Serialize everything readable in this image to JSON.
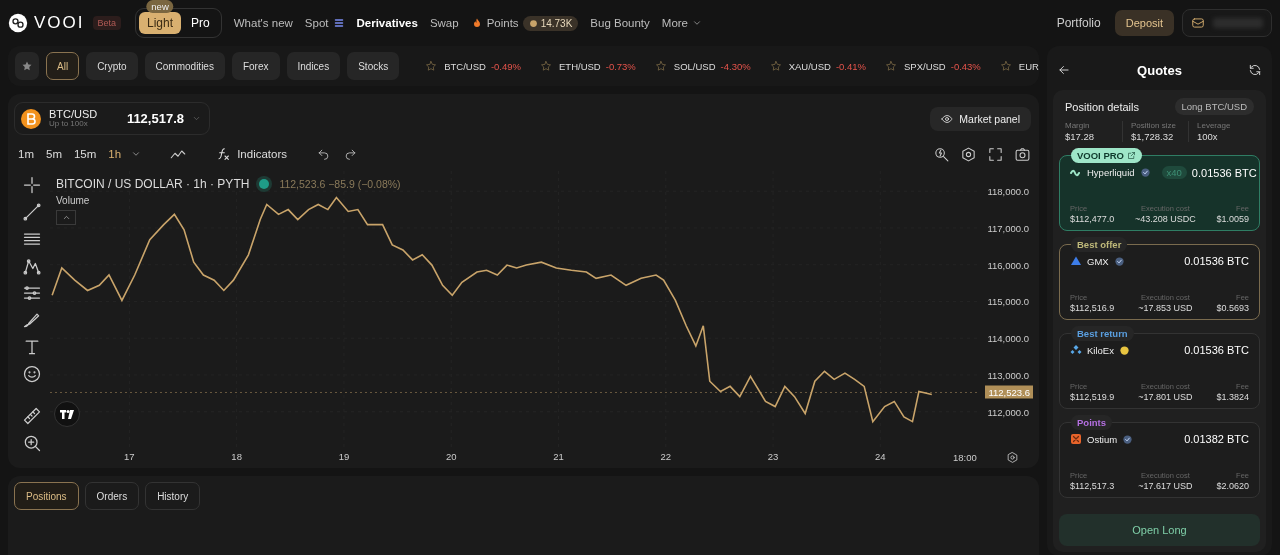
{
  "header": {
    "logo": "VOOI",
    "beta": "Beta",
    "modes": [
      {
        "label": "Light",
        "badge": "new",
        "selected": true
      },
      {
        "label": "Pro",
        "selected": false
      }
    ],
    "nav": [
      {
        "kind": "link",
        "label": "What's new",
        "selected": false
      },
      {
        "kind": "spot",
        "label": "Spot",
        "selected": false
      },
      {
        "kind": "link",
        "label": "Derivatives",
        "selected": true
      },
      {
        "kind": "link",
        "label": "Swap",
        "selected": false
      },
      {
        "kind": "points",
        "label": "Points",
        "badge": "14.73K",
        "selected": false
      },
      {
        "kind": "link",
        "label": "Bug Bounty",
        "selected": false
      },
      {
        "kind": "menu",
        "label": "More",
        "selected": false
      }
    ],
    "portfolio": "Portfolio",
    "deposit": "Deposit"
  },
  "filters": [
    {
      "label": "All",
      "selected": true
    },
    {
      "label": "Crypto",
      "selected": false
    },
    {
      "label": "Commodities",
      "selected": false
    },
    {
      "label": "Forex",
      "selected": false
    },
    {
      "label": "Indices",
      "selected": false
    },
    {
      "label": "Stocks",
      "selected": false
    }
  ],
  "tickers": [
    {
      "pair": "BTC/USD",
      "change": "-0.49%"
    },
    {
      "pair": "ETH/USD",
      "change": "-0.73%"
    },
    {
      "pair": "SOL/USD",
      "change": "-4.30%"
    },
    {
      "pair": "XAU/USD",
      "change": "-0.41%"
    },
    {
      "pair": "SPX/USD",
      "change": "-0.43%"
    },
    {
      "pair": "EUR"
    }
  ],
  "market": {
    "pair": "BTC/USD",
    "leverage": "Up to 100x",
    "price": "112,517.8",
    "panel_button": "Market panel"
  },
  "toolbar": {
    "intervals": [
      {
        "label": "1m",
        "selected": false
      },
      {
        "label": "5m",
        "selected": false
      },
      {
        "label": "15m",
        "selected": false
      },
      {
        "label": "1h",
        "selected": true
      }
    ],
    "indicators": "Indicators"
  },
  "chart": {
    "legend": "BITCOIN / US DOLLAR · 1h · PYTH",
    "quote": "112,523.6 −85.9 (−0.08%)",
    "volume": "Volume",
    "chart_data": {
      "type": "line",
      "x": [
        16.28,
        16.37,
        16.49,
        16.61,
        16.72,
        16.81,
        16.93,
        17.05,
        17.19,
        17.32,
        17.42,
        17.51,
        17.6,
        17.69,
        17.79,
        17.88,
        17.97,
        18.11,
        18.22,
        18.28,
        18.39,
        18.48,
        18.57,
        18.67,
        18.76,
        18.85,
        18.93,
        19.04,
        19.13,
        19.22,
        19.36,
        19.45,
        19.55,
        19.64,
        19.73,
        19.82,
        19.92,
        20.01,
        20.1,
        20.24,
        20.33,
        20.43,
        20.52,
        20.61,
        20.7,
        20.84,
        20.98,
        21.12,
        21.26,
        21.35,
        21.49,
        21.63,
        21.77,
        21.91,
        21.98,
        22.09,
        22.19,
        22.28,
        22.35,
        22.41,
        22.51,
        22.6,
        22.69,
        22.79,
        22.93,
        23.02,
        23.11,
        23.2,
        23.3,
        23.39,
        23.48,
        23.57,
        23.67,
        23.76,
        23.85,
        23.93,
        24.04,
        24.13,
        24.22,
        24.3,
        24.36,
        24.48
      ],
      "series": [
        {
          "color": "#c9a46a",
          "values": [
            115170,
            115910,
            115580,
            115300,
            115440,
            115720,
            115030,
            115720,
            116680,
            117090,
            117370,
            116950,
            116070,
            115720,
            115580,
            115300,
            115580,
            116270,
            117230,
            117640,
            117370,
            117500,
            117230,
            117500,
            117640,
            117500,
            117830,
            117450,
            117500,
            117090,
            117090,
            116540,
            116400,
            116130,
            116270,
            115990,
            115440,
            115170,
            115520,
            115800,
            115850,
            115720,
            115990,
            115910,
            115990,
            116070,
            115910,
            115850,
            115800,
            115630,
            115720,
            115440,
            115630,
            115720,
            115580,
            115030,
            114340,
            113790,
            114340,
            112830,
            112550,
            112690,
            112410,
            112960,
            112280,
            112140,
            112690,
            112410,
            111950,
            112830,
            113100,
            112880,
            113050,
            112880,
            112690,
            111730,
            112140,
            112280,
            111860,
            111730,
            112550,
            112470
          ]
        }
      ],
      "xlim": [
        16.26,
        24.92
      ],
      "ylim": [
        111040,
        118550
      ],
      "xticks": [
        17,
        18,
        19,
        20,
        21,
        22,
        23,
        24
      ],
      "yticks": [
        {
          "value": 112000,
          "label": "112,000.0"
        },
        {
          "value": 113000,
          "label": "113,000.0"
        },
        {
          "value": 114000,
          "label": "114,000.0"
        },
        {
          "value": 115000,
          "label": "115,000.0"
        },
        {
          "value": 116000,
          "label": "116,000.0"
        },
        {
          "value": 117000,
          "label": "117,000.0"
        },
        {
          "value": 118000,
          "label": "118,000.0"
        }
      ],
      "grid": true,
      "ref_lines": [
        {
          "axis": "y",
          "value": 112523.6,
          "label": "112,523.6"
        }
      ]
    },
    "time_label": "18:00"
  },
  "bottom_tabs": [
    {
      "label": "Positions",
      "selected": true
    },
    {
      "label": "Orders",
      "selected": false
    },
    {
      "label": "History",
      "selected": false
    }
  ],
  "quotes": {
    "title": "Quotes",
    "position_title": "Position details",
    "side": "Long BTC/USD",
    "stats": [
      {
        "label": "Margin",
        "value": "$17.28"
      },
      {
        "label": "Position size",
        "value": "$1,728.32"
      },
      {
        "label": "Leverage",
        "value": "100x"
      }
    ],
    "offers": [
      {
        "kind": "wave",
        "tag": "VOOI PRO",
        "external": true,
        "color": "#9ee6c8",
        "venue": "Hyperliquid",
        "multiplier": "x40",
        "amount": "0.01536 BTC",
        "price_label": "Price",
        "price": "$112,477.0",
        "cost_label": "Execution cost",
        "cost": "~43.208 USDC",
        "fee_label": "Fee",
        "fee": "$1.0059",
        "selected": true,
        "outlined": false
      },
      {
        "kind": "triangle",
        "tag": "Best offer",
        "external": false,
        "color": "#bfb97a",
        "venue": "GMX",
        "amount": "0.01536 BTC",
        "price_label": "Price",
        "price": "$112,516.9",
        "cost_label": "Execution cost",
        "cost": "~17.853 USD",
        "fee_label": "Fee",
        "fee": "$0.5693",
        "selected": false,
        "outlined": true
      },
      {
        "kind": "diamond",
        "tag": "Best return",
        "external": false,
        "color": "#5a9fe0",
        "venue": "KiloEx",
        "amount": "0.01536 BTC",
        "price_label": "Price",
        "price": "$112,519.9",
        "cost_label": "Execution cost",
        "cost": "~17.801 USD",
        "fee_label": "Fee",
        "fee": "$1.3824",
        "selected": false,
        "outlined": false
      },
      {
        "kind": "square",
        "tag": "Points",
        "external": false,
        "color": "#b46fe0",
        "venue": "Ostium",
        "amount": "0.01382 BTC",
        "price_label": "Price",
        "price": "$112,517.3",
        "cost_label": "Execution cost",
        "cost": "~17.617 USD",
        "fee_label": "Fee",
        "fee": "$2.0620",
        "selected": false,
        "outlined": false
      }
    ],
    "action": "Open Long"
  }
}
